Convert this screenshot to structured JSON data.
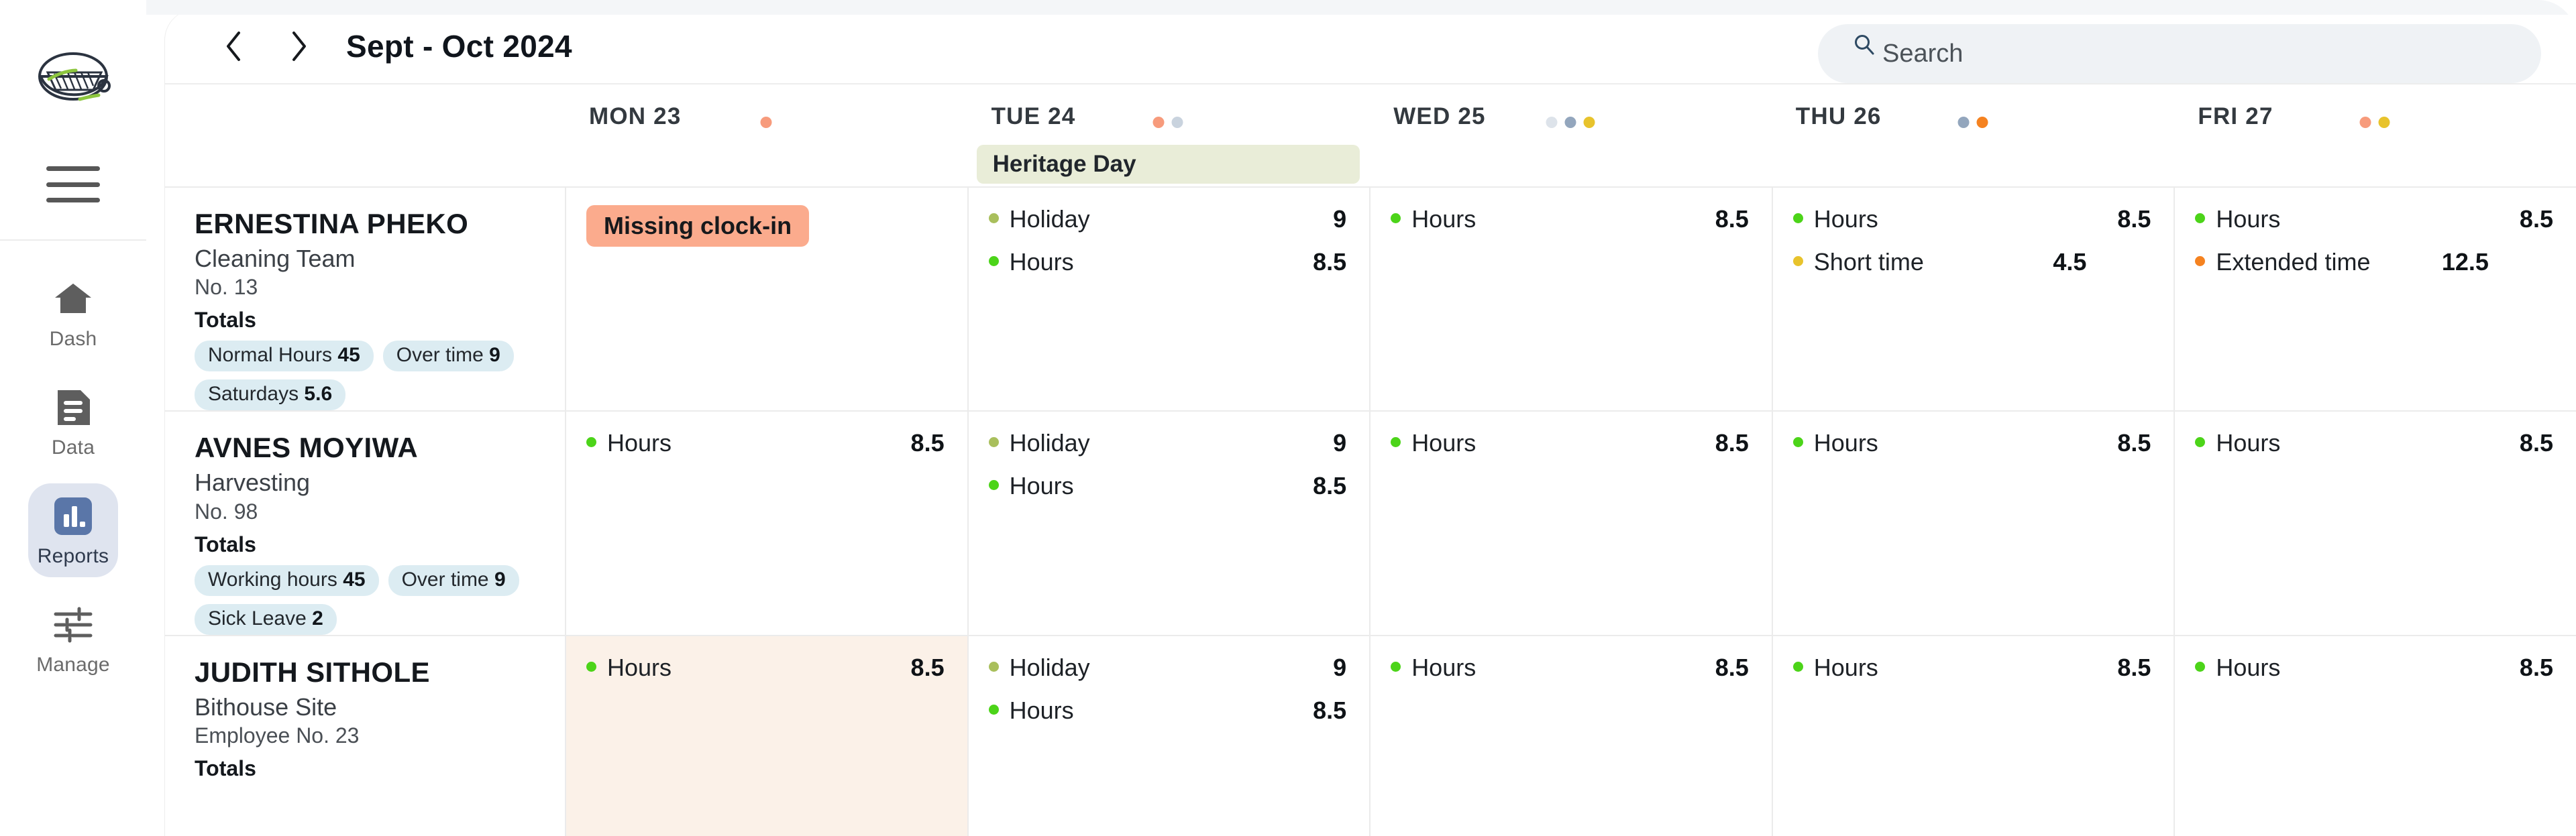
{
  "sidebar": {
    "logo_name": "app-logo",
    "menu_button": "hamburger-menu",
    "items": [
      {
        "label": "Dash",
        "icon": "home-icon",
        "active": false
      },
      {
        "label": "Data",
        "icon": "document-icon",
        "active": false
      },
      {
        "label": "Reports",
        "icon": "bar-chart-icon",
        "active": true
      },
      {
        "label": "Manage",
        "icon": "sliders-icon",
        "active": false
      }
    ]
  },
  "toolbar": {
    "prev_label": "‹",
    "next_label": "›",
    "period": "Sept - Oct 2024"
  },
  "search": {
    "placeholder": "Search",
    "value": ""
  },
  "colors": {
    "accent_blue": "#5a76a8",
    "chip_blue": "#dcecf2",
    "alert_salmon": "#fbab8d",
    "holiday_green": "#e9edd8",
    "highlight_cream": "#fbf1e8",
    "dot_green": "#4cd419",
    "dot_olive": "#a9bf5c",
    "dot_yellow": "#e8c32c",
    "dot_orange": "#f58220",
    "dot_salmon": "#f79b7c",
    "dot_slate": "#93a6bd",
    "dot_pale": "#dde3ea"
  },
  "days": [
    {
      "label": "MON 23",
      "dots": [
        "#f79b7c"
      ],
      "holiday": null
    },
    {
      "label": "TUE 24",
      "dots": [
        "#f79b7c",
        "#c9d3de"
      ],
      "holiday": "Heritage Day"
    },
    {
      "label": "WED 25",
      "dots": [
        "#dde3ea",
        "#93a6bd",
        "#e8c32c"
      ],
      "holiday": null
    },
    {
      "label": "THU 26",
      "dots": [
        "#93a6bd",
        "#f58220"
      ],
      "holiday": null
    },
    {
      "label": "FRI 27",
      "dots": [
        "#f79b7c",
        "#e8c32c"
      ],
      "holiday": null
    }
  ],
  "rows": [
    {
      "name": "ERNESTINA PHEKO",
      "team": "Cleaning Team",
      "number": "No. 13",
      "totals_label": "Totals",
      "chips": [
        {
          "label": "Normal Hours",
          "value": "45"
        },
        {
          "label": "Over time",
          "value": "9"
        },
        {
          "label": "Saturdays",
          "value": "5.6"
        }
      ],
      "cells": [
        {
          "highlight": false,
          "alert": "Missing clock-in",
          "entries": []
        },
        {
          "highlight": false,
          "alert": null,
          "entries": [
            {
              "title": "Holiday",
              "value": "9",
              "color": "#a9bf5c",
              "align": "right"
            },
            {
              "title": "Hours",
              "value": "8.5",
              "color": "#4cd419",
              "align": "right"
            }
          ]
        },
        {
          "highlight": false,
          "alert": null,
          "entries": [
            {
              "title": "Hours",
              "value": "8.5",
              "color": "#4cd419",
              "align": "right"
            }
          ]
        },
        {
          "highlight": false,
          "alert": null,
          "entries": [
            {
              "title": "Hours",
              "value": "8.5",
              "color": "#4cd419",
              "align": "right"
            },
            {
              "title": "Short time",
              "value": "4.5",
              "color": "#e8c32c",
              "align": "mid"
            }
          ]
        },
        {
          "highlight": false,
          "alert": null,
          "entries": [
            {
              "title": "Hours",
              "value": "8.5",
              "color": "#4cd419",
              "align": "right"
            },
            {
              "title": "Extended time",
              "value": "12.5",
              "color": "#f58220",
              "align": "mid"
            }
          ]
        }
      ]
    },
    {
      "name": "AVNES MOYIWA",
      "team": "Harvesting",
      "number": "No. 98",
      "totals_label": "Totals",
      "chips": [
        {
          "label": "Working hours",
          "value": "45"
        },
        {
          "label": "Over time",
          "value": "9"
        },
        {
          "label": "Sick Leave",
          "value": "2"
        }
      ],
      "cells": [
        {
          "highlight": false,
          "alert": null,
          "entries": [
            {
              "title": "Hours",
              "value": "8.5",
              "color": "#4cd419",
              "align": "right"
            }
          ]
        },
        {
          "highlight": false,
          "alert": null,
          "entries": [
            {
              "title": "Holiday",
              "value": "9",
              "color": "#a9bf5c",
              "align": "right"
            },
            {
              "title": "Hours",
              "value": "8.5",
              "color": "#4cd419",
              "align": "right"
            }
          ]
        },
        {
          "highlight": false,
          "alert": null,
          "entries": [
            {
              "title": "Hours",
              "value": "8.5",
              "color": "#4cd419",
              "align": "right"
            }
          ]
        },
        {
          "highlight": false,
          "alert": null,
          "entries": [
            {
              "title": "Hours",
              "value": "8.5",
              "color": "#4cd419",
              "align": "right"
            }
          ]
        },
        {
          "highlight": false,
          "alert": null,
          "entries": [
            {
              "title": "Hours",
              "value": "8.5",
              "color": "#4cd419",
              "align": "right"
            }
          ]
        }
      ]
    },
    {
      "name": "JUDITH SITHOLE",
      "team": "Bithouse Site",
      "number": "Employee No. 23",
      "totals_label": "Totals",
      "chips": [],
      "cells": [
        {
          "highlight": true,
          "alert": null,
          "entries": [
            {
              "title": "Hours",
              "value": "8.5",
              "color": "#4cd419",
              "align": "right"
            }
          ]
        },
        {
          "highlight": false,
          "alert": null,
          "entries": [
            {
              "title": "Holiday",
              "value": "9",
              "color": "#a9bf5c",
              "align": "right"
            },
            {
              "title": "Hours",
              "value": "8.5",
              "color": "#4cd419",
              "align": "right"
            }
          ]
        },
        {
          "highlight": false,
          "alert": null,
          "entries": [
            {
              "title": "Hours",
              "value": "8.5",
              "color": "#4cd419",
              "align": "right"
            }
          ]
        },
        {
          "highlight": false,
          "alert": null,
          "entries": [
            {
              "title": "Hours",
              "value": "8.5",
              "color": "#4cd419",
              "align": "right"
            }
          ]
        },
        {
          "highlight": false,
          "alert": null,
          "entries": [
            {
              "title": "Hours",
              "value": "8.5",
              "color": "#4cd419",
              "align": "right"
            }
          ]
        }
      ]
    }
  ]
}
